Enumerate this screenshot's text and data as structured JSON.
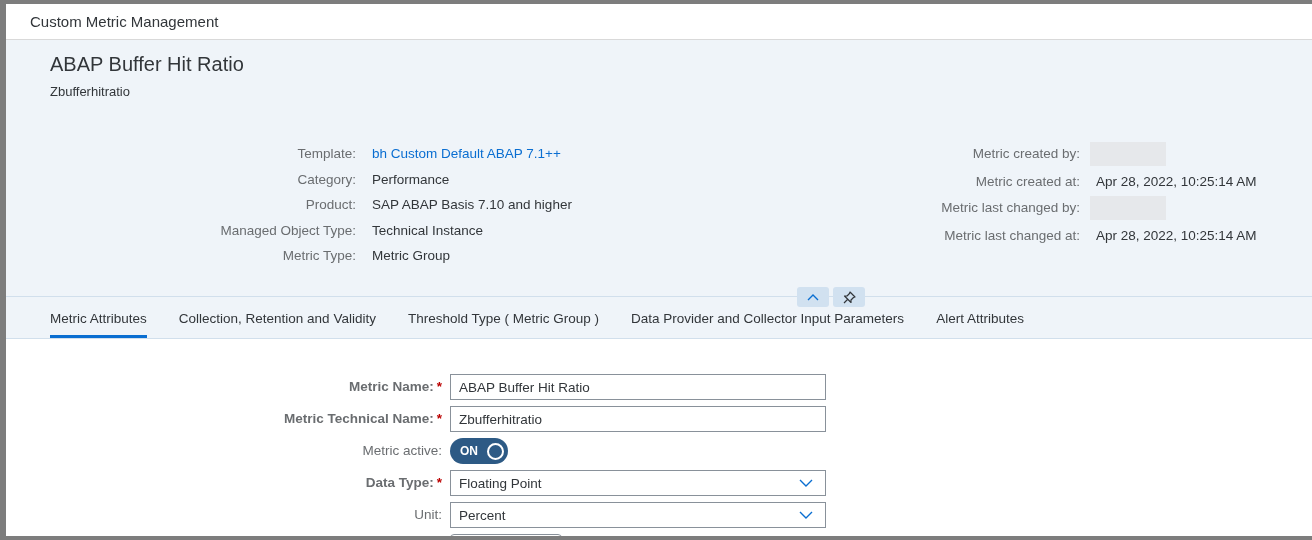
{
  "window": {
    "title": "Custom Metric Management"
  },
  "header": {
    "title": "ABAP Buffer Hit Ratio",
    "subtitle": "Zbufferhitratio",
    "attributes_left": [
      {
        "label": "Template:",
        "value": "bh Custom Default ABAP 7.1++",
        "kind": "link"
      },
      {
        "label": "Category:",
        "value": "Performance",
        "kind": "text"
      },
      {
        "label": "Product:",
        "value": "SAP ABAP Basis 7.10 and higher",
        "kind": "text"
      },
      {
        "label": "Managed Object Type:",
        "value": "Technical Instance",
        "kind": "text"
      },
      {
        "label": "Metric Type:",
        "value": "Metric Group",
        "kind": "text"
      }
    ],
    "attributes_right": [
      {
        "label": "Metric created by:",
        "kind": "redacted"
      },
      {
        "label": "Metric created at:",
        "value": "Apr 28, 2022, 10:25:14 AM",
        "kind": "text"
      },
      {
        "label": "Metric last changed by:",
        "kind": "redacted"
      },
      {
        "label": "Metric last changed at:",
        "value": "Apr 28, 2022, 10:25:14 AM",
        "kind": "text"
      }
    ]
  },
  "tabs": [
    {
      "label": "Metric Attributes",
      "selected": true
    },
    {
      "label": "Collection, Retention and Validity",
      "selected": false
    },
    {
      "label": "Threshold Type ( Metric Group )",
      "selected": false
    },
    {
      "label": "Data Provider and Collector Input Parameters",
      "selected": false
    },
    {
      "label": "Alert Attributes",
      "selected": false
    }
  ],
  "form": [
    {
      "label": "Metric Name:",
      "required": true,
      "required_mark": "*",
      "kind": "input",
      "value": "ABAP Buffer Hit Ratio"
    },
    {
      "label": "Metric Technical Name:",
      "required": true,
      "required_mark": "*",
      "kind": "input",
      "value": "Zbufferhitratio"
    },
    {
      "label": "Metric active:",
      "required": false,
      "kind": "switch",
      "on": true,
      "value": "ON"
    },
    {
      "label": "Data Type:",
      "required": true,
      "required_mark": "*",
      "kind": "select",
      "value": "Floating Point"
    },
    {
      "label": "Unit:",
      "required": false,
      "kind": "select",
      "value": "Percent"
    }
  ]
}
